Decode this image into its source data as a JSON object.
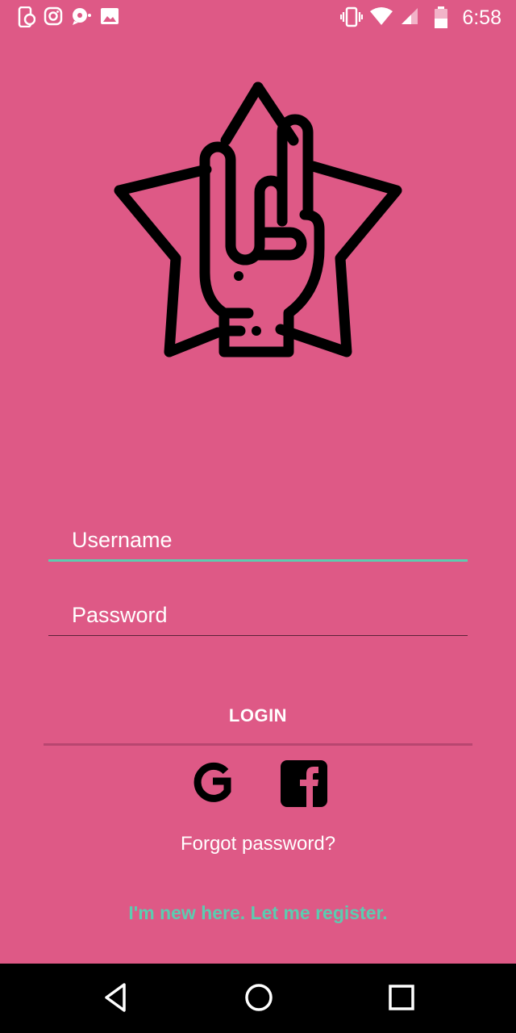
{
  "status_bar": {
    "time": "6:58",
    "left_icons": [
      "phone-sync-icon",
      "instagram-icon",
      "chat-icon",
      "image-icon"
    ],
    "right_icons": [
      "vibrate-icon",
      "wifi-icon",
      "signal-icon",
      "battery-icon"
    ]
  },
  "logo": {
    "icon": "rock-hand-star-icon"
  },
  "form": {
    "username_placeholder": "Username",
    "password_placeholder": "Password",
    "login_label": "LOGIN"
  },
  "social": {
    "google_icon": "google-icon",
    "facebook_icon": "facebook-icon"
  },
  "links": {
    "forgot": "Forgot password?",
    "register": "I'm new here. Let me register."
  },
  "colors": {
    "background": "#DE5986",
    "accent": "#5CCCB0",
    "text": "#FFFFFF"
  },
  "nav_bar": {
    "icons": [
      "back-icon",
      "home-icon",
      "recents-icon"
    ]
  }
}
